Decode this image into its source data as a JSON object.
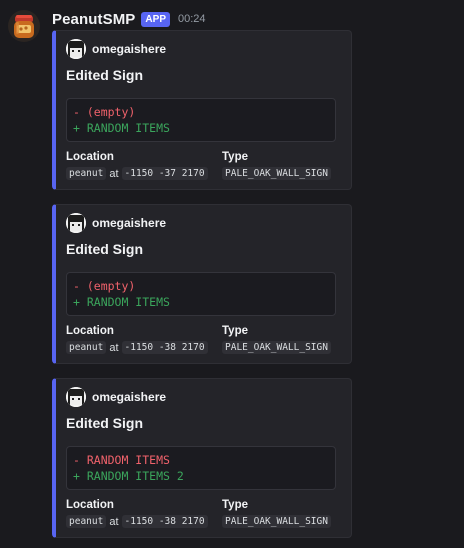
{
  "message": {
    "author": "PeanutSMP",
    "badge": "APP",
    "timestamp": "00:24",
    "avatar_icon": "peanut-jar-icon"
  },
  "embeds": [
    {
      "author_name": "omegaishere",
      "author_icon": "player-head-icon",
      "title": "Edited Sign",
      "diff": {
        "removed": "- (empty)",
        "added": "+ RANDOM ITEMS"
      },
      "location_label": "Location",
      "location": {
        "world": "peanut",
        "at": "at",
        "coords": "-1150 -37 2170"
      },
      "type_label": "Type",
      "type_value": "PALE_OAK_WALL_SIGN"
    },
    {
      "author_name": "omegaishere",
      "author_icon": "player-head-icon",
      "title": "Edited Sign",
      "diff": {
        "removed": "- (empty)",
        "added": "+ RANDOM ITEMS"
      },
      "location_label": "Location",
      "location": {
        "world": "peanut",
        "at": "at",
        "coords": "-1150 -38 2170"
      },
      "type_label": "Type",
      "type_value": "PALE_OAK_WALL_SIGN"
    },
    {
      "author_name": "omegaishere",
      "author_icon": "player-head-icon",
      "title": "Edited Sign",
      "diff": {
        "removed": "- RANDOM ITEMS",
        "added": "+ RANDOM ITEMS 2"
      },
      "location_label": "Location",
      "location": {
        "world": "peanut",
        "at": "at",
        "coords": "-1150 -38 2170"
      },
      "type_label": "Type",
      "type_value": "PALE_OAK_WALL_SIGN"
    }
  ],
  "colors": {
    "embed_accent": "#5865f2",
    "diff_removed": "#f0626b",
    "diff_added": "#3ba55c",
    "background": "#1a1a1e"
  }
}
